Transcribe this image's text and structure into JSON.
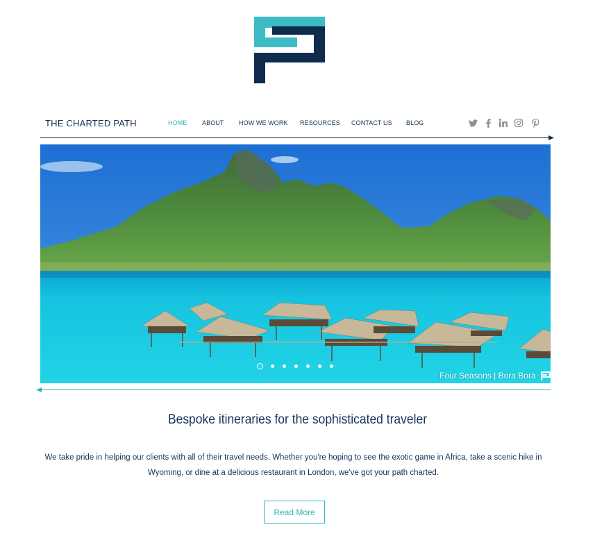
{
  "brand": {
    "name": "THE CHARTED PATH"
  },
  "nav": {
    "items": [
      {
        "label": "HOME",
        "active": true
      },
      {
        "label": "ABOUT",
        "active": false
      },
      {
        "label": "HOW WE WORK",
        "active": false
      },
      {
        "label": "RESOURCES",
        "active": false
      },
      {
        "label": "CONTACT US",
        "active": false
      },
      {
        "label": "BLOG",
        "active": false
      }
    ]
  },
  "social": [
    "twitter-icon",
    "facebook-icon",
    "linkedin-icon",
    "instagram-icon",
    "pinterest-icon"
  ],
  "slideshow": {
    "caption": "Four Seasons | Bora Bora",
    "slide_count": 7,
    "active_slide": 1
  },
  "content": {
    "headline": "Bespoke itineraries for the sophisticated traveler",
    "body": "We take pride in helping our clients with all of their travel needs. Whether you're hoping to see the exotic game in Africa, take a scenic hike in Wyoming, or dine at a delicious restaurant in London, we've got your path charted.",
    "button_label": "Read More"
  },
  "colors": {
    "navy": "#0f2c4f",
    "teal": "#3dbcc5",
    "accent": "#2fb4bd"
  }
}
